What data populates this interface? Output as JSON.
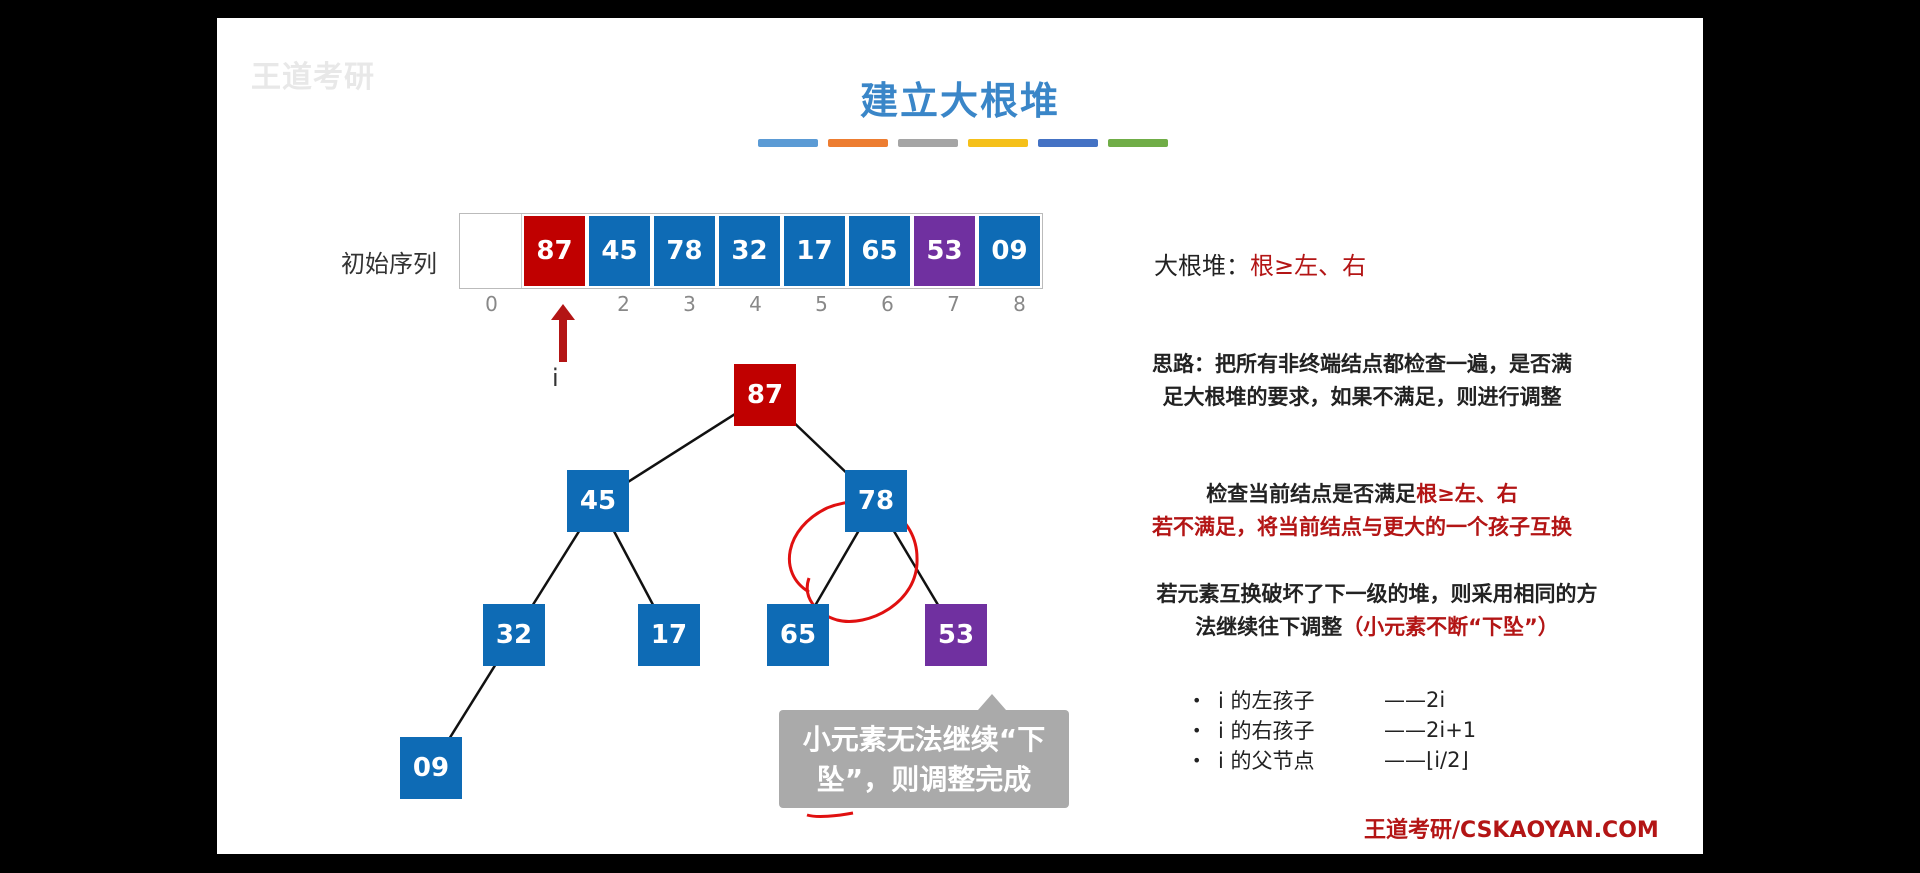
{
  "watermark": "王道考研",
  "title": "建立大根堆",
  "colorbars": [
    "#5b9bd5",
    "#ed7d31",
    "#a5a5a5",
    "#f5c01a",
    "#4472c4",
    "#70ad47"
  ],
  "sequence": {
    "label": "初始序列",
    "cells": [
      {
        "value": "",
        "color": "#ffffff"
      },
      {
        "value": "87",
        "color": "#c00000"
      },
      {
        "value": "45",
        "color": "#0e6bb5"
      },
      {
        "value": "78",
        "color": "#0e6bb5"
      },
      {
        "value": "32",
        "color": "#0e6bb5"
      },
      {
        "value": "17",
        "color": "#0e6bb5"
      },
      {
        "value": "65",
        "color": "#0e6bb5"
      },
      {
        "value": "53",
        "color": "#7030a0"
      },
      {
        "value": "09",
        "color": "#0e6bb5"
      }
    ],
    "indices": [
      "0",
      "",
      "2",
      "3",
      "4",
      "5",
      "6",
      "7",
      "8"
    ],
    "pointer_label": "i"
  },
  "tree": {
    "nodes": [
      {
        "id": "n1",
        "value": "87",
        "color": "#c00000"
      },
      {
        "id": "n2",
        "value": "45",
        "color": "#0e6bb5"
      },
      {
        "id": "n3",
        "value": "78",
        "color": "#0e6bb5"
      },
      {
        "id": "n4",
        "value": "32",
        "color": "#0e6bb5"
      },
      {
        "id": "n5",
        "value": "17",
        "color": "#0e6bb5"
      },
      {
        "id": "n6",
        "value": "65",
        "color": "#0e6bb5"
      },
      {
        "id": "n7",
        "value": "53",
        "color": "#7030a0"
      },
      {
        "id": "n8",
        "value": "09",
        "color": "#0e6bb5"
      }
    ],
    "edges": [
      [
        "n1",
        "n2"
      ],
      [
        "n1",
        "n3"
      ],
      [
        "n2",
        "n4"
      ],
      [
        "n2",
        "n5"
      ],
      [
        "n3",
        "n6"
      ],
      [
        "n3",
        "n7"
      ],
      [
        "n4",
        "n8"
      ]
    ]
  },
  "heap_def": {
    "prefix": "大根堆：",
    "rule": "根≥左、右"
  },
  "note1": {
    "line1": "思路：把所有非终端结点都检查一遍，是否满",
    "line2": "足大根堆的要求，如果不满足，则进行调整"
  },
  "note2": {
    "line1_black": "检查当前结点是否满足",
    "line1_red": "根≥左、右",
    "line2": "若不满足，将当前结点与更大的一个孩子互换"
  },
  "note3": {
    "line1": "若元素互换破坏了下一级的堆，则采用相同的方",
    "line2_black": "法继续往下调整",
    "line2_red": "（小元素不断“下坠”）"
  },
  "bullets": [
    {
      "label": "i 的左孩子",
      "value": "——2i"
    },
    {
      "label": "i 的右孩子",
      "value": "——2i+1"
    },
    {
      "label": "i 的父节点",
      "value": "——⌊i/2⌋"
    }
  ],
  "tooltip": {
    "line1": "小元素无法继续“下",
    "line2": "坠”，则调整完成"
  },
  "brand": "王道考研/CSKAOYAN.COM",
  "annotation_color": "#e01010"
}
